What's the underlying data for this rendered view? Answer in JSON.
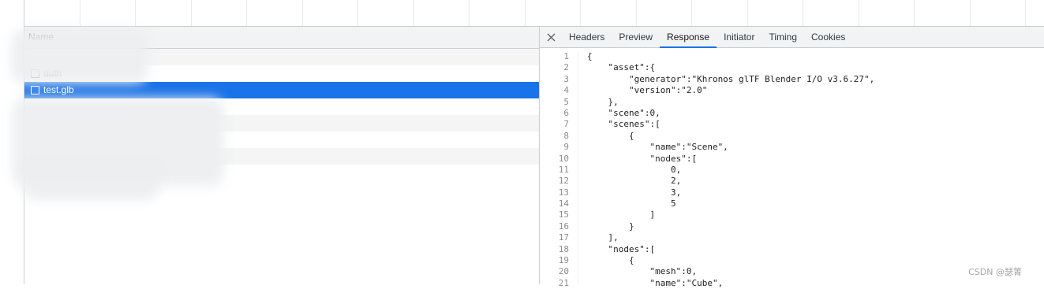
{
  "request_list": {
    "header": "Name",
    "rows": [
      {
        "label": "auth",
        "selected": false
      },
      {
        "label": "test.glb",
        "selected": true
      }
    ]
  },
  "details": {
    "close_icon": "close-icon",
    "tabs": [
      {
        "label": "Headers"
      },
      {
        "label": "Preview"
      },
      {
        "label": "Response",
        "active": true
      },
      {
        "label": "Initiator"
      },
      {
        "label": "Timing"
      },
      {
        "label": "Cookies"
      }
    ],
    "response_lines": [
      {
        "n": "1",
        "t": "{"
      },
      {
        "n": "2",
        "t": "    \"asset\":{"
      },
      {
        "n": "3",
        "t": "        \"generator\":\"Khronos glTF Blender I/O v3.6.27\","
      },
      {
        "n": "4",
        "t": "        \"version\":\"2.0\""
      },
      {
        "n": "5",
        "t": "    },"
      },
      {
        "n": "6",
        "t": "    \"scene\":0,"
      },
      {
        "n": "7",
        "t": "    \"scenes\":["
      },
      {
        "n": "8",
        "t": "        {"
      },
      {
        "n": "9",
        "t": "            \"name\":\"Scene\","
      },
      {
        "n": "10",
        "t": "            \"nodes\":["
      },
      {
        "n": "11",
        "t": "                0,"
      },
      {
        "n": "12",
        "t": "                2,"
      },
      {
        "n": "13",
        "t": "                3,"
      },
      {
        "n": "14",
        "t": "                5"
      },
      {
        "n": "15",
        "t": "            ]"
      },
      {
        "n": "16",
        "t": "        }"
      },
      {
        "n": "17",
        "t": "    ],"
      },
      {
        "n": "18",
        "t": "    \"nodes\":["
      },
      {
        "n": "19",
        "t": "        {"
      },
      {
        "n": "20",
        "t": "            \"mesh\":0,"
      },
      {
        "n": "21",
        "t": "            \"name\":\"Cube\","
      }
    ]
  },
  "watermark": "CSDN @瑟箐",
  "colors": {
    "selection": "#1a73e8",
    "active_tab_underline": "#1a73e8"
  }
}
